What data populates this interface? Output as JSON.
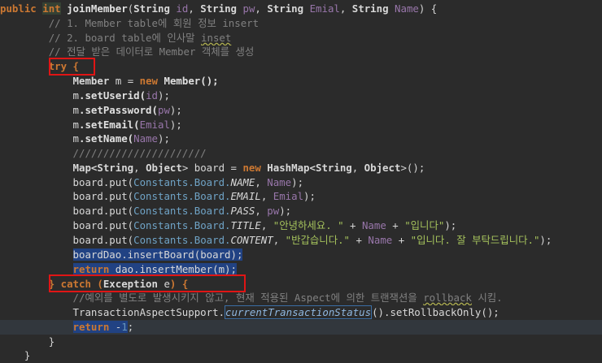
{
  "code": {
    "l1": {
      "public": "public",
      "int": "int",
      "method": "joinMember",
      "p1t": "String",
      "p1n": "id",
      "p2t": "String",
      "p2n": "pw",
      "p3t": "String",
      "p3n": "Emial",
      "p4t": "String",
      "p4n": "Name",
      "brace": ") {"
    },
    "l2": "// 1. Member table에 회원 정보 insert",
    "l3a": "// 2. board table에 인사말 ",
    "l3b": "inset",
    "l4": "// 전달 받은 데이터로 Member 객체를 생성",
    "l5": "try {",
    "l6": {
      "type": "Member",
      "var": "m",
      "op": " = ",
      "new": "new",
      "call": "Member();"
    },
    "l7": {
      "obj": "m",
      "method": ".setUserid(",
      "arg": "id",
      "end": ");"
    },
    "l8": {
      "obj": "m",
      "method": ".setPassword(",
      "arg": "pw",
      "end": ");"
    },
    "l9": {
      "obj": "m",
      "method": ".setEmail(",
      "arg": "Emial",
      "end": ");"
    },
    "l10": {
      "obj": "m",
      "method": ".setName(",
      "arg": "Name",
      "end": ");"
    },
    "l11": "//////////////////////",
    "l12": {
      "a": "Map<",
      "b": "String",
      "c": ", ",
      "d": "Object",
      "e": "> ",
      "f": "board",
      "g": " = ",
      "h": "new",
      "i": " HashMap<",
      "j": "String",
      "k": ", ",
      "l": "Object",
      "m": ">();"
    },
    "l13": {
      "a": "board.put(",
      "b": "Constants.Board.",
      "c": "NAME",
      "d": ", ",
      "e": "Name",
      "f": ");"
    },
    "l14": {
      "a": "board.put(",
      "b": "Constants.Board.",
      "c": "EMAIL",
      "d": ", ",
      "e": "Emial",
      "f": ");"
    },
    "l15": {
      "a": "board.put(",
      "b": "Constants.Board.",
      "c": "PASS",
      "d": ", ",
      "e": "pw",
      "f": ");"
    },
    "l16": {
      "a": "board.put(",
      "b": "Constants.Board.",
      "c": "TITLE",
      "d": ", ",
      "e": "\"안녕하세요. \"",
      "f": " + ",
      "g": "Name",
      "h": " + ",
      "i": "\"입니다\"",
      "j": ");"
    },
    "l17": {
      "a": "board.put(",
      "b": "Constants.Board.",
      "c": "CONTENT",
      "d": ", ",
      "e": "\"반갑습니다.\"",
      "f": " + ",
      "g": "Name",
      "h": " + ",
      "i": "\"입니다. 잘 부탁드립니다.\"",
      "j": ");"
    },
    "l18": {
      "a": "boardDao.insertBoard(",
      "b": "board",
      "c": ");"
    },
    "l19": {
      "a": "return",
      "b": " dao.insertMember(",
      "c": "m",
      "d": ");"
    },
    "l20": {
      "a": "} catch (",
      "b": "Exception",
      "c": " ",
      "d": "e",
      "e": ") {"
    },
    "l21a": "//예외를 별도로 발생시키지 않고, 현재 적용된 Aspect에 의한 트랜잭션을 ",
    "l21b": "rollback",
    "l21c": " 시킴.",
    "l22": {
      "a": "TransactionAspectSupport.",
      "b": "currentTransactionStatus",
      "c": "().setRollbackOnly();"
    },
    "l23": {
      "a": "return",
      "b": " -",
      "c": "1",
      "d": ";"
    },
    "l24": "}",
    "l25": "}"
  }
}
